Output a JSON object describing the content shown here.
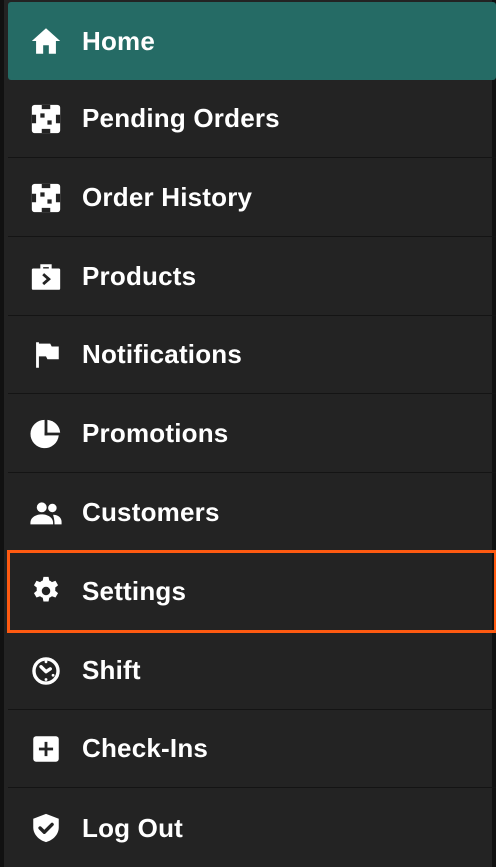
{
  "menu": {
    "items": [
      {
        "label": "Home",
        "icon": "home-icon",
        "state": "active"
      },
      {
        "label": "Pending Orders",
        "icon": "orders-icon"
      },
      {
        "label": "Order History",
        "icon": "order-history-icon"
      },
      {
        "label": "Products",
        "icon": "briefcase-icon"
      },
      {
        "label": "Notifications",
        "icon": "flag-icon"
      },
      {
        "label": "Promotions",
        "icon": "pie-chart-icon"
      },
      {
        "label": "Customers",
        "icon": "people-icon"
      },
      {
        "label": "Settings",
        "icon": "gear-icon",
        "state": "highlighted"
      },
      {
        "label": "Shift",
        "icon": "timer-icon"
      },
      {
        "label": "Check-Ins",
        "icon": "plus-square-icon"
      },
      {
        "label": "Log Out",
        "icon": "shield-check-icon"
      }
    ]
  },
  "colors": {
    "active_background": "#256b65",
    "menu_background": "#232323",
    "highlight_outline": "#ff5a11",
    "text": "#ffffff"
  }
}
